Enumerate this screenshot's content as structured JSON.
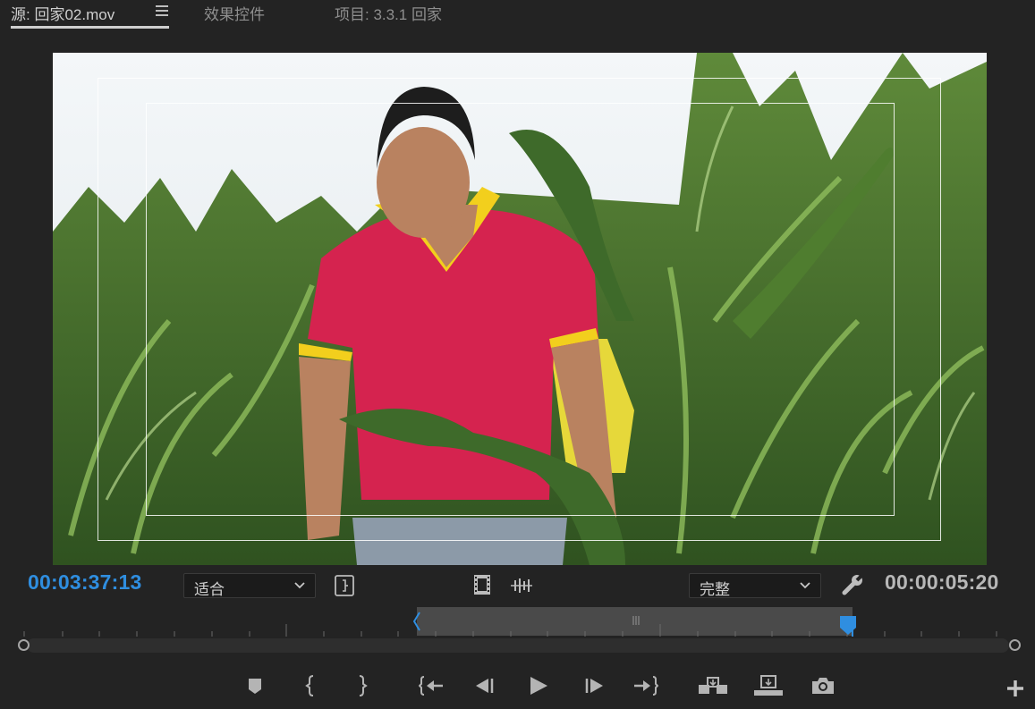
{
  "tabs": [
    {
      "label": "源: 回家02.mov",
      "active": true
    },
    {
      "label": "效果控件",
      "active": false
    },
    {
      "label": "项目: 3.3.1 回家",
      "active": false
    }
  ],
  "playhead_timecode": "00:03:37:13",
  "duration_timecode": "00:00:05:20",
  "zoom_select": {
    "value": "适合"
  },
  "resolution_select": {
    "value": "完整"
  },
  "colors": {
    "accent_timecode": "#2f8ee0",
    "panel_bg": "#232323",
    "playhead": "#2f8ee0"
  },
  "icons": {
    "tab_menu": "hamburger-icon",
    "insert_marker_bracket": "bracket-icon",
    "drag_video": "film-icon",
    "drag_audio": "waveform-icon",
    "settings": "wrench-icon",
    "add_button": "plus-icon"
  },
  "transport": [
    {
      "name": "add-marker-button",
      "icon": "marker-icon"
    },
    {
      "name": "mark-in-button",
      "icon": "mark-in-icon"
    },
    {
      "name": "mark-out-button",
      "icon": "mark-out-icon"
    },
    {
      "name": "go-to-in-button",
      "icon": "go-to-in-icon"
    },
    {
      "name": "step-back-button",
      "icon": "step-back-icon"
    },
    {
      "name": "play-button",
      "icon": "play-icon"
    },
    {
      "name": "step-forward-button",
      "icon": "step-forward-icon"
    },
    {
      "name": "go-to-out-button",
      "icon": "go-to-out-icon"
    },
    {
      "name": "insert-button",
      "icon": "insert-icon"
    },
    {
      "name": "overwrite-button",
      "icon": "overwrite-icon"
    },
    {
      "name": "export-frame-button",
      "icon": "camera-icon"
    }
  ]
}
